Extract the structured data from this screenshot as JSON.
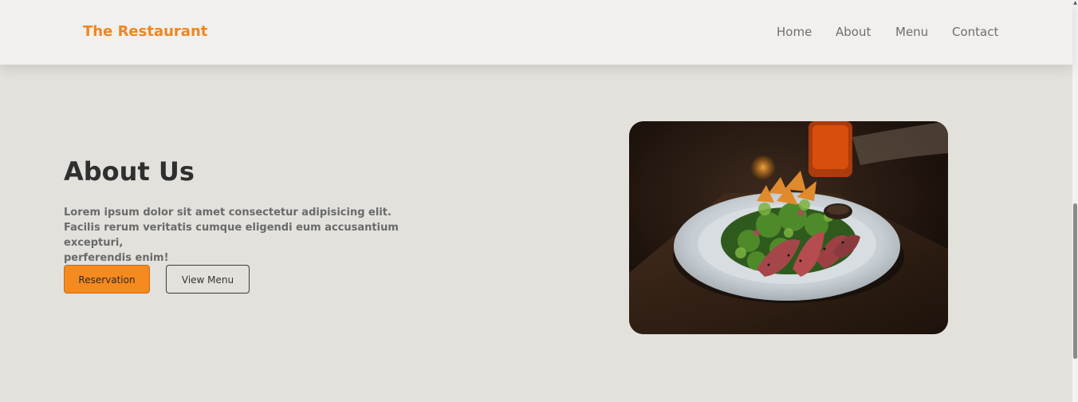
{
  "brand": "The Restaurant",
  "nav": {
    "home": "Home",
    "about": "About",
    "menu": "Menu",
    "contact": "Contact"
  },
  "about": {
    "title": "About Us",
    "lines": [
      "Lorem ipsum dolor sit amet consectetur adipisicing elit.",
      "Facilis rerum veritatis cumque eligendi eum accusantium excepturi,",
      "perferendis enim!"
    ],
    "reservation_label": "Reservation",
    "view_menu_label": "View Menu"
  },
  "colors": {
    "accent": "#f58a1f",
    "brand": "#f08520",
    "background": "#e3e1dc",
    "navbar": "#f1f0ec"
  }
}
